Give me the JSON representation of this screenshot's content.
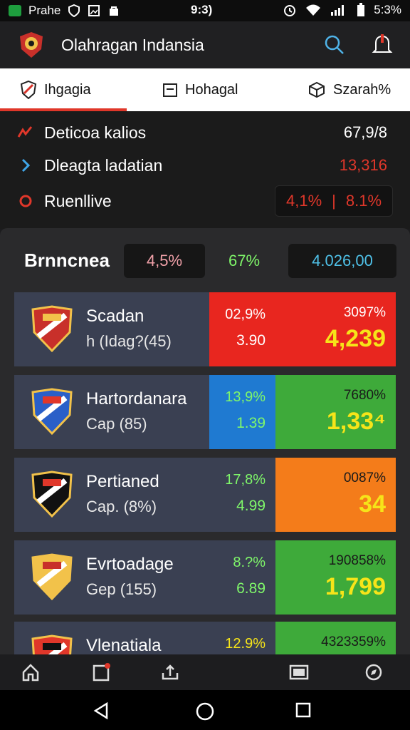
{
  "status_bar": {
    "carrier": "Prahe",
    "time": "9:3)",
    "battery": "5:3%",
    "icons": [
      "app-notification-icon",
      "shield-icon",
      "image-icon",
      "bag-icon",
      "alarm-icon",
      "wifi-icon",
      "signal-icon",
      "battery-icon"
    ]
  },
  "app_bar": {
    "title": "Olahragan Indansia",
    "icons": [
      "club-logo-icon",
      "search-icon",
      "notification-bell-icon"
    ]
  },
  "tabs": [
    {
      "label": "Ihgagia",
      "icon": "shield-badge-icon",
      "active": true
    },
    {
      "label": "Hohagal",
      "icon": "calendar-icon",
      "active": false
    },
    {
      "label": "Szarah%",
      "icon": "cube-icon",
      "active": false
    }
  ],
  "summary": {
    "rows": [
      {
        "label": "Deticoa kalios",
        "value": "67,9/8",
        "icon": "trend-icon"
      },
      {
        "label": "Dleagta ladatian",
        "value": "13,316",
        "icon": "chevron-right-icon"
      },
      {
        "label": "Ruenllive",
        "icon": "circle-icon",
        "pct_a": "4,1%",
        "separator": "|",
        "pct_b": "8.1%"
      }
    ]
  },
  "panel": {
    "title": "Brnncnea",
    "stat_a": "4,5%",
    "stat_b": "67%",
    "stat_c": "4.026,00"
  },
  "teams": [
    {
      "name": "Scadan",
      "sub": "h  (Idag?(45)",
      "pct1": "02,9%",
      "val1": "3.90",
      "pct2": "3097%",
      "val2": "4,239",
      "bg1": "#e8261f",
      "bg2": "#e8261f",
      "text1": "#ffffff",
      "crest": "crest-icon"
    },
    {
      "name": "Hartordanara",
      "sub": "Cap  (85)",
      "pct1": "13,9%",
      "val1": "1.39",
      "pct2": "7680%",
      "val2": "1,33⁴",
      "bg1": "#1f7ad1",
      "bg2": "#3eaa3a",
      "text1": "#7ff76a",
      "crest": "crest-icon"
    },
    {
      "name": "Pertianed",
      "sub": "Cap.  (8%)",
      "pct1": "17,8%",
      "val1": "4.99",
      "pct2": "0087%",
      "val2": "34",
      "bg1": "#3a4052",
      "bg2": "#f47c1a",
      "text1": "#7ff76a",
      "crest": "crest-icon"
    },
    {
      "name": "Evrtoadage",
      "sub": "Gep  (155)",
      "pct1": "8.?%",
      "val1": "6.89",
      "pct2": "190858%",
      "val2": "1,799",
      "bg1": "#3a4052",
      "bg2": "#3eaa3a",
      "text1": "#7ff76a",
      "crest": "crest-icon"
    },
    {
      "name": "Vlenatiala",
      "sub": "",
      "pct1": "12.9%",
      "val1": "",
      "pct2": "4323359%",
      "val2": "",
      "bg1": "#3a4052",
      "bg2": "#3eaa3a",
      "text1": "#f6e419",
      "crest": "crest-icon"
    }
  ],
  "bottom_nav": [
    "home-icon",
    "news-icon",
    "upload-icon",
    "tv-icon",
    "compass-icon"
  ],
  "system_nav": [
    "back-icon",
    "home-circle-icon",
    "recents-icon"
  ],
  "colors": {
    "accent": "#e0372a",
    "card": "#3a4052",
    "highlight": "#f6e419"
  }
}
